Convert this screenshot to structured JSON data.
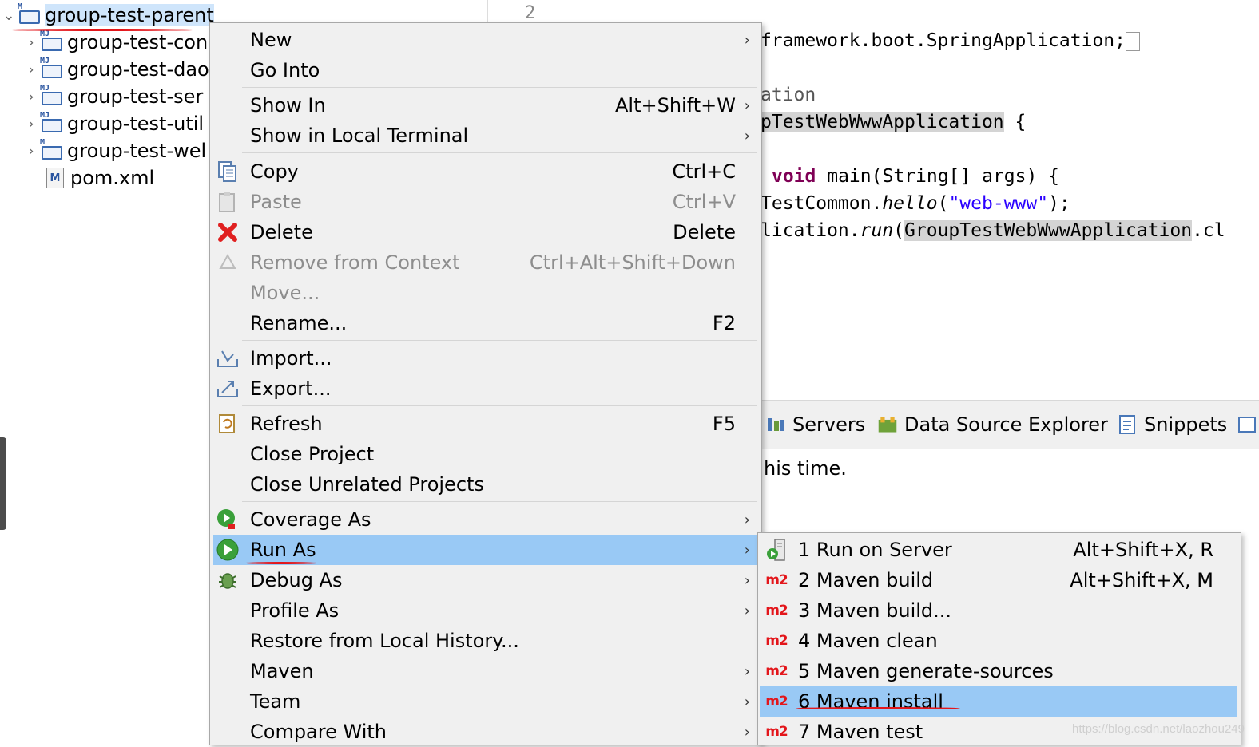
{
  "explorer": {
    "root": "group-test-parent",
    "children": [
      "group-test-con",
      "group-test-dao",
      "group-test-ser",
      "group-test-util",
      "group-test-wel"
    ],
    "pom": "pom.xml"
  },
  "editor": {
    "line_number": "2",
    "lines": {
      "l1": "framework.boot.SpringApplication;",
      "l2": "ation",
      "l3a": "pTestWebWwwApplication",
      "l3b": " {",
      "l4_kw": "void",
      "l4_rest": " main(String[] args) {",
      "l5a": "TestCommon.",
      "l5b": "hello",
      "l5c": "(",
      "l5d": "\"web-www\"",
      "l5e": ");",
      "l6a": "lication.",
      "l6b": "run",
      "l6c": "(",
      "l6d": "GroupTestWebWwwApplication",
      "l6e": ".cl"
    }
  },
  "bottom_panel": {
    "tabs": [
      "Servers",
      "Data Source Explorer",
      "Snippets"
    ],
    "message": "his time."
  },
  "context_menu": {
    "items": [
      {
        "label": "New",
        "shortcut": ""
      },
      {
        "label": "Go Into",
        "shortcut": ""
      },
      {
        "label": "Show In",
        "shortcut": "Alt+Shift+W"
      },
      {
        "label": "Show in Local Terminal",
        "shortcut": ""
      },
      {
        "label": "Copy",
        "shortcut": "Ctrl+C"
      },
      {
        "label": "Paste",
        "shortcut": "Ctrl+V"
      },
      {
        "label": "Delete",
        "shortcut": "Delete"
      },
      {
        "label": "Remove from Context",
        "shortcut": "Ctrl+Alt+Shift+Down"
      },
      {
        "label": "Move...",
        "shortcut": ""
      },
      {
        "label": "Rename...",
        "shortcut": "F2"
      },
      {
        "label": "Import...",
        "shortcut": ""
      },
      {
        "label": "Export...",
        "shortcut": ""
      },
      {
        "label": "Refresh",
        "shortcut": "F5"
      },
      {
        "label": "Close Project",
        "shortcut": ""
      },
      {
        "label": "Close Unrelated Projects",
        "shortcut": ""
      },
      {
        "label": "Coverage As",
        "shortcut": ""
      },
      {
        "label": "Run As",
        "shortcut": ""
      },
      {
        "label": "Debug As",
        "shortcut": ""
      },
      {
        "label": "Profile As",
        "shortcut": ""
      },
      {
        "label": "Restore from Local History...",
        "shortcut": ""
      },
      {
        "label": "Maven",
        "shortcut": ""
      },
      {
        "label": "Team",
        "shortcut": ""
      },
      {
        "label": "Compare With",
        "shortcut": ""
      }
    ]
  },
  "run_as_submenu": {
    "items": [
      {
        "label": "1 Run on Server",
        "shortcut": "Alt+Shift+X, R"
      },
      {
        "label": "2 Maven build",
        "shortcut": "Alt+Shift+X, M"
      },
      {
        "label": "3 Maven build...",
        "shortcut": ""
      },
      {
        "label": "4 Maven clean",
        "shortcut": ""
      },
      {
        "label": "5 Maven generate-sources",
        "shortcut": ""
      },
      {
        "label": "6 Maven install",
        "shortcut": ""
      },
      {
        "label": "7 Maven test",
        "shortcut": ""
      }
    ],
    "m2_badge": "m2"
  },
  "watermark": "https://blog.csdn.net/laozhou249",
  "colors": {
    "menu_bg": "#f0f0f0",
    "highlight": "#99c9f5",
    "selection": "#cfe5fb",
    "annotation_red": "#e3161b",
    "keyword": "#7f0055",
    "string": "#2a00ff"
  }
}
